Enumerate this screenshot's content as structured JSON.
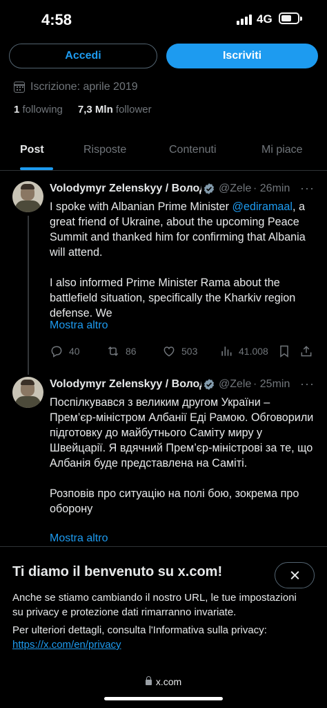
{
  "status_bar": {
    "time": "4:58",
    "network": "4G"
  },
  "header": {
    "login_label": "Accedi",
    "signup_label": "Iscriviti"
  },
  "profile": {
    "joined": "Iscrizione: aprile 2019",
    "following_count": "1",
    "following_label": "following",
    "followers_count": "7,3 Mln",
    "followers_label": "follower"
  },
  "tabs": [
    "Post",
    "Risposte",
    "Contenuti",
    "Mi piace"
  ],
  "tweets": [
    {
      "name": "Volodymyr Zelenskyy / Володимир Зеленський",
      "handle": "@ZelenskyyUa",
      "time": "26min",
      "text_before_mention": "I spoke with Albanian Prime Minister ",
      "mention": "@ediramaal",
      "text_after_mention": ", a great friend of Ukraine, about the upcoming Peace Summit and thanked him for confirming that Albania will attend.",
      "paragraph2": "I also informed Prime Minister Rama about the battlefield situation, specifically the Kharkiv region defense. We",
      "show_more": "Mostra altro",
      "replies": "40",
      "reposts": "86",
      "likes": "503",
      "views": "41.008"
    },
    {
      "name": "Volodymyr Zelenskyy / Володимир Зеленський",
      "handle": "@ZelenskyyUa",
      "time": "25min",
      "paragraph1": "Поспілкувався з великим другом України – Прем’єр-міністром Албанії Еді Рамою. Обговорили підготовку до майбутнього Саміту миру у Швейцарії. Я вдячний Прем’єр-міністрові за те, що Албанія буде представлена на Саміті.",
      "paragraph2": "Розповів про ситуацію на полі бою, зокрема про оборону",
      "show_more": "Mostra altro"
    }
  ],
  "welcome_sheet": {
    "title": "Ti diamo il benvenuto su x.com!",
    "body1": "Anche se stiamo cambiando il nostro URL, le tue impostazioni su privacy e protezione dati rimarranno invariate.",
    "body2": "Per ulteriori dettagli, consulta l'Informativa sulla privacy: ",
    "privacy_link": "https://x.com/en/privacy"
  },
  "browser": {
    "url": "x.com"
  },
  "colors": {
    "accent": "#1d9bf0",
    "background": "#000000",
    "muted": "#71767b"
  }
}
